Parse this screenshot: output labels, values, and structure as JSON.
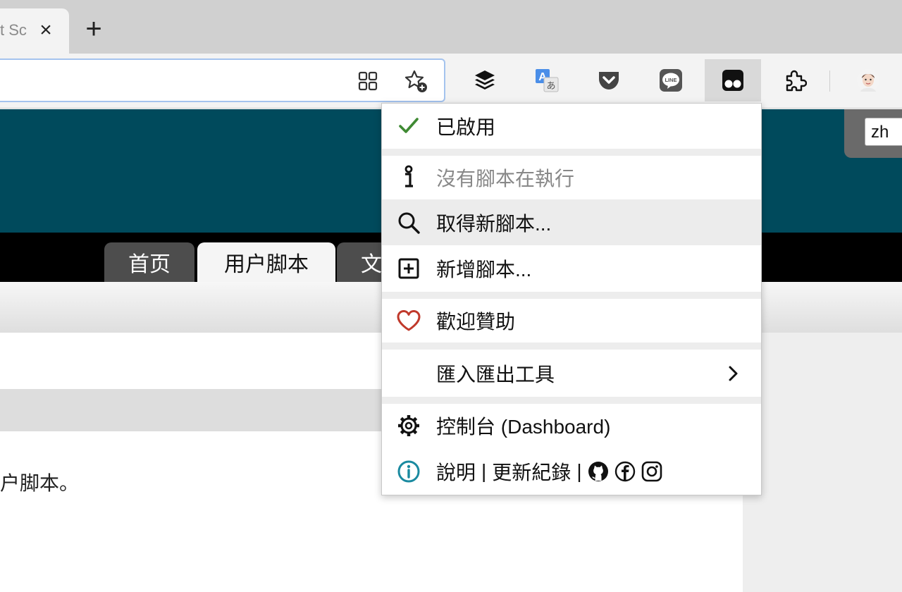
{
  "browser": {
    "tab_title": "t Sc",
    "close_glyph": "×",
    "new_tab_glyph": "+",
    "extensions": [
      "buffer-layers-icon",
      "translate-icon",
      "pocket-icon",
      "line-icon",
      "tampermonkey-icon",
      "extensions-puzzle-icon",
      "profile-avatar"
    ]
  },
  "page": {
    "language": "zh",
    "nav_tabs": [
      "首页",
      "用户脚本",
      "文"
    ],
    "body_text": "户脚本。"
  },
  "menu": {
    "enabled": "已啟用",
    "no_scripts": "沒有腳本在執行",
    "get_new": "取得新腳本...",
    "add_new": "新增腳本...",
    "donate": "歡迎贊助",
    "utilities": "匯入匯出工具",
    "dashboard": "控制台 (Dashboard)",
    "help": "說明",
    "pipe1": "|",
    "changelog": "更新紀錄",
    "pipe2": "|"
  },
  "colors": {
    "check": "#3f8a33",
    "heart": "#c0392b",
    "info": "#1a8aa0",
    "hero": "#004a5c"
  }
}
